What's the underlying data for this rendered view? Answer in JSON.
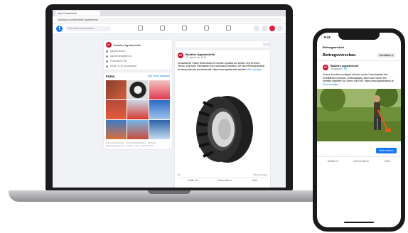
{
  "browser": {
    "tab_label": "Jetzt Facebook",
    "url": "facebook.com/Bodelex.Agrartechnik"
  },
  "fb": {
    "search_placeholder": "Facebook durchsuchen"
  },
  "page": {
    "name": "Bodelex Agrartechnik",
    "logo_text": "AT",
    "info": [
      "agrartechnik.at",
      "agrartechnik@info.at",
      "Preisspanne: €€",
      "Heute: 11:18 Geschlossen"
    ],
    "photos_title": "Fotos",
    "photos_link": "Alle Fotos anzeigen",
    "footer": "Datenschutzrichtlinie · Nutzungsbedingungen · Werbung · Datenschutzoptionen · Cookies · Mehr · Meta © 2023"
  },
  "post": {
    "author": "Bodelex Agrartechnik",
    "time": "17. Januar um 10:21",
    "text": "Sensationelle Traktor Reifendeals mit höchster Qualität und bestem Grip für jedes Terrain. Jetzt beim Fachhändler Ihres Vertrauens bestellen. Die neue Reifengeneration für anspruchsvolle Landwirtschaft.",
    "link": "https://www.agrartechnik.at/reifen",
    "more": "Mehr anzeigen",
    "reactions": "52",
    "comments": "3 Kommentare",
    "actions": [
      "Gefällt mir",
      "Kommentieren",
      "Teilen"
    ]
  },
  "phone": {
    "time": "9:41",
    "menu_label": "Beitragsansicht",
    "title": "Beitragsvorschau",
    "tag_button": "Hochladen ▾",
    "author": "Bodelex Agrartechnik",
    "meta": "Gesponsert · 🌐",
    "text": "Unsere Kundinnen pflegen mit dem neuen Freischneider ihre Grünflächen mühelos. Leistungsstark, leicht und robust: Der perfekte Begleiter für Garten und Feld.",
    "link_text": "https://www.agrartechnik.at",
    "more": "Mehr anzeigen",
    "cta": "Jetzt ansehen",
    "actions": [
      "Gefällt mir",
      "Kommentieren",
      "Teilen"
    ]
  },
  "colors": {
    "fb_blue": "#1877f2",
    "brand_red": "#c8102e"
  }
}
